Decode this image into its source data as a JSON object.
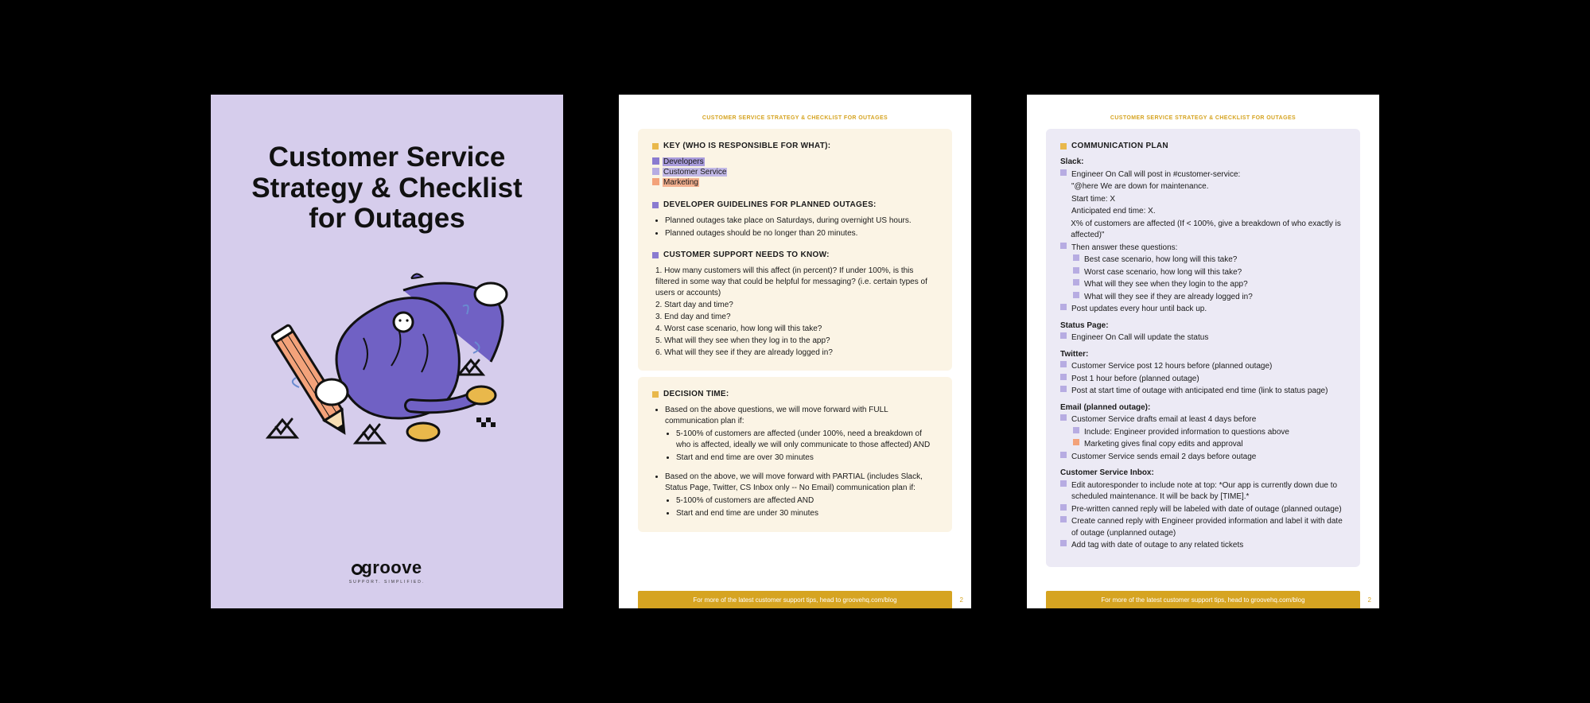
{
  "cover": {
    "title": "Customer Service Strategy & Checklist for Outages",
    "logo": "groove",
    "logo_sub": "SUPPORT. SIMPLIFIED."
  },
  "eyebrow": "CUSTOMER SERVICE STRATEGY & CHECKLIST FOR OUTAGES",
  "page2": {
    "key": {
      "heading": "KEY (WHO IS RESPONSIBLE FOR WHAT):",
      "items": [
        {
          "label": "Developers",
          "cls": "dev",
          "sq": "violet"
        },
        {
          "label": "Customer Service",
          "cls": "cs",
          "sq": "vlight"
        },
        {
          "label": "Marketing",
          "cls": "mk",
          "sq": "peach"
        }
      ]
    },
    "dev": {
      "heading": "DEVELOPER GUIDELINES FOR PLANNED OUTAGES:",
      "bullets": [
        "Planned outages take place on Saturdays, during overnight US hours.",
        "Planned outages should be no longer than 20 minutes."
      ]
    },
    "support": {
      "heading": "CUSTOMER SUPPORT NEEDS TO KNOW:",
      "items": [
        "1. How many customers will this affect (in percent)? If under 100%, is this filtered in some way that could be helpful for messaging? (i.e. certain types of users or accounts)",
        "2. Start day and time?",
        "3. End day and time?",
        "4. Worst case scenario, how long will this take?",
        "5. What will they see when they log in to the app?",
        "6. What will they see if they are already logged in?"
      ]
    },
    "decision": {
      "heading": "DECISION TIME:",
      "full_intro": "Based on the above questions, we will move forward with FULL communication plan if:",
      "full": [
        "5-100% of customers are affected (under 100%, need a breakdown of who is affected, ideally we will only communicate to those affected) AND",
        "Start and end time are over 30 minutes"
      ],
      "partial_intro": "Based on the above, we will move forward with PARTIAL (includes Slack, Status Page, Twitter,  CS Inbox only -- No Email) communication plan if:",
      "partial": [
        "5-100% of customers are affected AND",
        "Start and end time are under 30 minutes"
      ]
    },
    "page_number": "2"
  },
  "page3": {
    "heading": "COMMUNICATION PLAN",
    "slack": {
      "label": "Slack:",
      "rows": [
        {
          "sq": "vlight",
          "t": "Engineer On Call will post in #customer-service:"
        },
        {
          "t": "\"@here We are down for maintenance."
        },
        {
          "t": "Start time: X"
        },
        {
          "t": "Anticipated end time: X."
        },
        {
          "t": "X% of customers are affected (If < 100%, give a breakdown of who exactly is affected)\""
        },
        {
          "sq": "vlight",
          "t": "Then answer these questions:"
        },
        {
          "sq": "vlight",
          "indent": 1,
          "t": "Best case scenario, how long will this take?"
        },
        {
          "sq": "vlight",
          "indent": 1,
          "t": "Worst case scenario, how long will this take?"
        },
        {
          "sq": "vlight",
          "indent": 1,
          "t": "What will they see when they login to the app?"
        },
        {
          "sq": "vlight",
          "indent": 1,
          "t": "What will they see if they are already logged in?"
        },
        {
          "sq": "vlight",
          "t": "Post updates every hour until back up."
        }
      ]
    },
    "status": {
      "label": "Status Page:",
      "rows": [
        {
          "sq": "vlight",
          "t": "Engineer On Call will update the status"
        }
      ]
    },
    "twitter": {
      "label": "Twitter:",
      "rows": [
        {
          "sq": "vlight",
          "t": "Customer Service post 12 hours before (planned outage)"
        },
        {
          "sq": "vlight",
          "t": "Post 1 hour before (planned outage)"
        },
        {
          "sq": "vlight",
          "t": "Post at start time of outage with anticipated end time (link to status page)"
        }
      ]
    },
    "email": {
      "label": "Email (planned outage):",
      "rows": [
        {
          "sq": "vlight",
          "t": "Customer Service drafts email at least 4 days before"
        },
        {
          "sq": "vlight",
          "indent": 1,
          "t": "Include: Engineer provided information to questions above"
        },
        {
          "sq": "peach",
          "indent": 1,
          "t": "Marketing gives final copy edits and approval"
        },
        {
          "sq": "vlight",
          "t": "Customer Service sends email 2 days before outage"
        }
      ]
    },
    "inbox": {
      "label": "Customer Service Inbox:",
      "rows": [
        {
          "sq": "vlight",
          "t": "Edit autoresponder to include note at top: *Our app is currently down due to scheduled maintenance. It will be back by [TIME].*"
        },
        {
          "sq": "vlight",
          "t": "Pre-written canned reply will be labeled with date of outage (planned outage)"
        },
        {
          "sq": "vlight",
          "t": "Create canned reply with Engineer provided information and label it with date of outage (unplanned outage)"
        },
        {
          "sq": "vlight",
          "t": "Add tag with date of outage to any related tickets"
        }
      ]
    },
    "page_number": "2"
  },
  "footer": "For more of the latest customer support tips, head to groovehq.com/blog"
}
